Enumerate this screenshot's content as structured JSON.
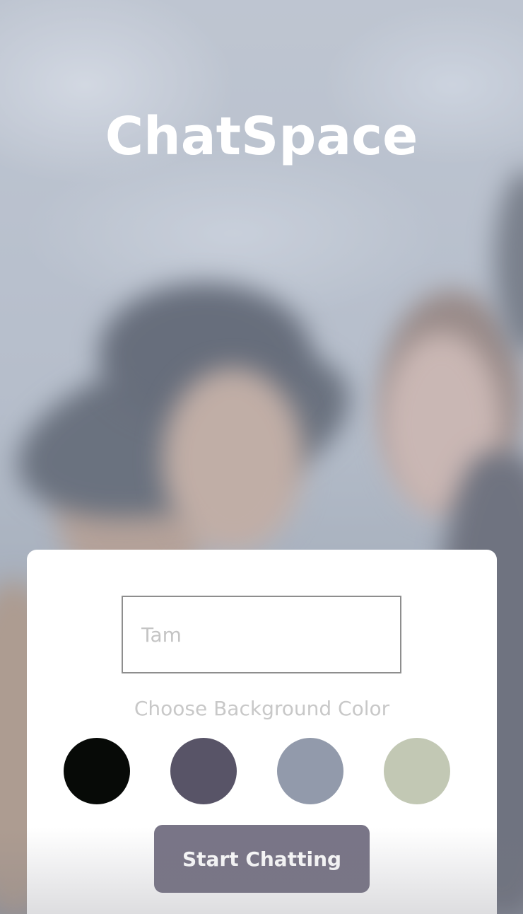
{
  "app": {
    "title": "ChatSpace"
  },
  "form": {
    "name_input": {
      "value": "",
      "placeholder": "Tam"
    },
    "color_label": "Choose Background Color",
    "colors": [
      {
        "name": "black",
        "hex": "#070a07"
      },
      {
        "name": "dark-purple",
        "hex": "#585467"
      },
      {
        "name": "slate-blue",
        "hex": "#929aab"
      },
      {
        "name": "sage-green",
        "hex": "#c2c8b4"
      }
    ],
    "start_button_label": "Start Chatting"
  },
  "theme": {
    "button_color": "#797587",
    "card_background": "#ffffff",
    "title_color": "#ffffff"
  }
}
